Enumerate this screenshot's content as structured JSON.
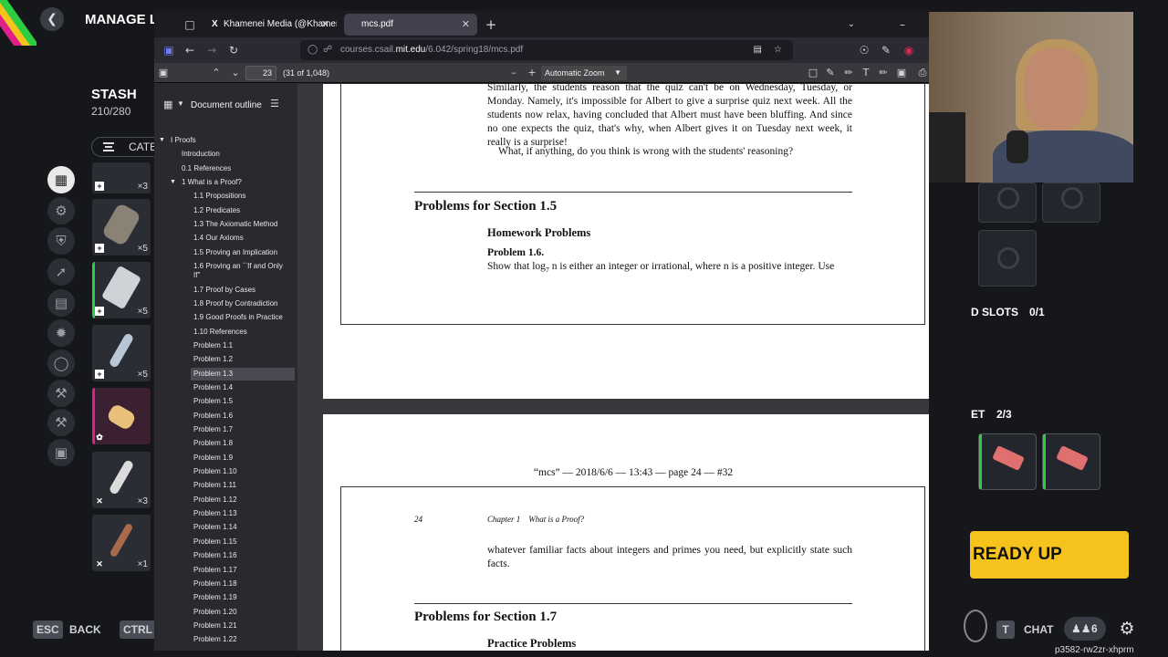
{
  "game": {
    "header_title": "MANAGE LO",
    "stash_title": "STASH",
    "stash_count": "210/280",
    "category_label": "CATE",
    "slot_qtys": [
      "×3",
      "×5",
      "×5",
      "×5",
      "",
      "×3",
      "×1"
    ],
    "slots_label": "D SLOTS",
    "slots_value": "0/1",
    "set_label": "ET",
    "set_value": "2/3",
    "ready_label": "READY UP",
    "esc_key": "ESC",
    "back_label": "BACK",
    "ctrl_key": "CTRL",
    "chat_key": "T",
    "chat_label": "CHAT",
    "party_count": "6",
    "player_id": "p3582-rw2zr-xhprm",
    "colors": {
      "ready": "#f6c21c",
      "slot_green": "#2ecc40",
      "slot_pink": "#e0208a"
    }
  },
  "browser": {
    "tabs": [
      {
        "label": "Khamenei Media (@Khamenei_",
        "icon": "x-logo-icon",
        "active": false
      },
      {
        "label": "mcs.pdf",
        "icon": "pdf-icon",
        "active": true
      }
    ],
    "url_prefix": "courses.csail.",
    "url_domain": "mit.edu",
    "url_suffix": "/6.042/spring18/mcs.pdf",
    "page_number": "23",
    "page_count": "(31 of 1,048)",
    "zoom": "Automatic Zoom"
  },
  "outline": {
    "title": "Document outline",
    "items": [
      {
        "label": "I Proofs",
        "level": 0,
        "arrow": true
      },
      {
        "label": "Introduction",
        "level": 1
      },
      {
        "label": "0.1 References",
        "level": 1
      },
      {
        "label": "1 What is a Proof?",
        "level": 1,
        "arrow": true
      },
      {
        "label": "1.1 Propositions",
        "level": 2
      },
      {
        "label": "1.2 Predicates",
        "level": 2
      },
      {
        "label": "1.3 The Axiomatic Method",
        "level": 2
      },
      {
        "label": "1.4 Our Axioms",
        "level": 2
      },
      {
        "label": "1.5 Proving an Implication",
        "level": 2
      },
      {
        "label": "1.6 Proving an ``If and Only",
        "label2": "If''",
        "level": 2
      },
      {
        "label": "1.7 Proof by Cases",
        "level": 2
      },
      {
        "label": "1.8 Proof by Contradiction",
        "level": 2
      },
      {
        "label": "1.9 Good Proofs in Practice",
        "level": 2
      },
      {
        "label": "1.10 References",
        "level": 2
      },
      {
        "label": "Problem 1.1",
        "level": 2
      },
      {
        "label": "Problem 1.2",
        "level": 2
      },
      {
        "label": "Problem 1.3",
        "level": 2,
        "selected": true
      },
      {
        "label": "Problem 1.4",
        "level": 2
      },
      {
        "label": "Problem 1.5",
        "level": 2
      },
      {
        "label": "Problem 1.6",
        "level": 2
      },
      {
        "label": "Problem 1.7",
        "level": 2
      },
      {
        "label": "Problem 1.8",
        "level": 2
      },
      {
        "label": "Problem 1.9",
        "level": 2
      },
      {
        "label": "Problem 1.10",
        "level": 2
      },
      {
        "label": "Problem 1.11",
        "level": 2
      },
      {
        "label": "Problem 1.12",
        "level": 2
      },
      {
        "label": "Problem 1.13",
        "level": 2
      },
      {
        "label": "Problem 1.14",
        "level": 2
      },
      {
        "label": "Problem 1.15",
        "level": 2
      },
      {
        "label": "Problem 1.16",
        "level": 2
      },
      {
        "label": "Problem 1.17",
        "level": 2
      },
      {
        "label": "Problem 1.18",
        "level": 2
      },
      {
        "label": "Problem 1.19",
        "level": 2
      },
      {
        "label": "Problem 1.20",
        "level": 2
      },
      {
        "label": "Problem 1.21",
        "level": 2
      },
      {
        "label": "Problem 1.22",
        "level": 2
      }
    ]
  },
  "pdf": {
    "page23": {
      "para1": "Similarly, the students reason that the quiz can't be on Wednesday, Tuesday, or Monday. Namely, it's impossible for Albert to give a surprise quiz next week. All the students now relax, having concluded that Albert must have been bluffing. And since no one expects the quiz, that's why, when Albert gives it on Tuesday next week, it really is a surprise!",
      "para2": "What, if anything, do you think is wrong with the students' reasoning?",
      "section_heading": "Problems for Section 1.5",
      "subsection": "Homework Problems",
      "problem_title": "Problem 1.6.",
      "problem_text_1": "Show that log",
      "problem_sub": "7",
      "problem_text_2": " n is either an integer or irrational, where n is a positive integer. Use"
    },
    "page24": {
      "running_head": "“mcs” — 2018/6/6 — 13:43 — page 24 — #32",
      "page_no": "24",
      "chapter_head": "Chapter 1    What is a Proof?",
      "para1": "whatever familiar facts about integers and primes you need, but explicitly state such facts.",
      "section_heading": "Problems for Section 1.7",
      "subsection": "Practice Problems"
    }
  }
}
